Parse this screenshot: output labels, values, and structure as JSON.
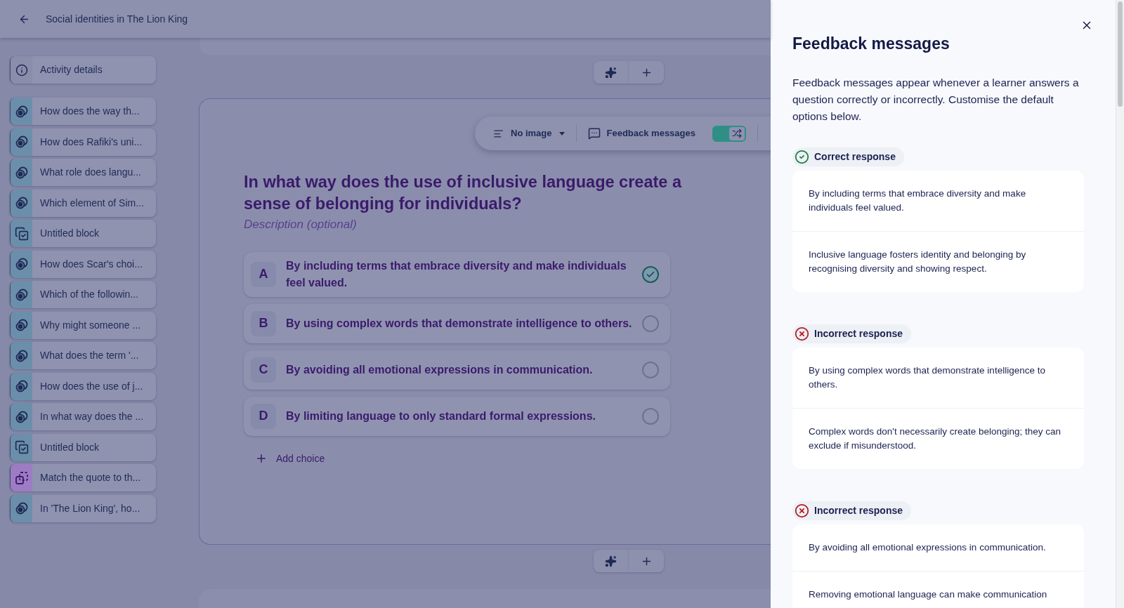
{
  "header": {
    "title": "Social identities in The Lion King"
  },
  "sidebar": {
    "details": {
      "label": "Activity details"
    },
    "items": [
      {
        "kind": "question",
        "label": "How does the way th..."
      },
      {
        "kind": "question",
        "label": "How does Rafiki's uni..."
      },
      {
        "kind": "question",
        "label": "What role does langu..."
      },
      {
        "kind": "question",
        "label": "Which element of Sim..."
      },
      {
        "kind": "block",
        "label": "Untitled block"
      },
      {
        "kind": "question",
        "label": "How does Scar's choi..."
      },
      {
        "kind": "question",
        "label": "Which of the followin..."
      },
      {
        "kind": "question",
        "label": "Why might someone ..."
      },
      {
        "kind": "question",
        "label": "What does the term '..."
      },
      {
        "kind": "question",
        "label": "How does the use of j..."
      },
      {
        "kind": "question",
        "label": "In what way does the ..."
      },
      {
        "kind": "block",
        "label": "Untitled block"
      },
      {
        "kind": "match",
        "label": "Match the quote to th..."
      },
      {
        "kind": "question",
        "label": "In 'The Lion King', ho..."
      }
    ]
  },
  "toolbar": {
    "image": "No image",
    "feedback": "Feedback messages",
    "shuffle_on": true
  },
  "question": {
    "title": "In what way does the use of inclusive language create a sense of belonging for individuals?",
    "description_placeholder": "Description (optional)",
    "choices": [
      {
        "letter": "A",
        "text": "By including terms that embrace diversity and make individuals feel valued.",
        "correct": true
      },
      {
        "letter": "B",
        "text": "By using complex words that demonstrate intelligence to others.",
        "correct": false
      },
      {
        "letter": "C",
        "text": "By avoiding all emotional expressions in communication.",
        "correct": false
      },
      {
        "letter": "D",
        "text": "By limiting language to only standard formal expressions.",
        "correct": false
      }
    ],
    "add_choice": "Add choice"
  },
  "drawer": {
    "title": "Feedback messages",
    "intro": "Feedback messages appear whenever a learner answers a question correctly or incorrectly. Customise the default options below.",
    "sections": [
      {
        "kind": "correct",
        "label": "Correct response",
        "messages": [
          "By including terms that embrace diversity and make individuals feel valued.",
          "Inclusive language fosters identity and belonging by recognising diversity and showing respect."
        ]
      },
      {
        "kind": "incorrect",
        "label": "Incorrect response",
        "messages": [
          "By using complex words that demonstrate intelligence to others.",
          "Complex words don't necessarily create belonging; they can exclude if misunderstood."
        ]
      },
      {
        "kind": "incorrect",
        "label": "Incorrect response",
        "messages": [
          "By avoiding all emotional expressions in communication.",
          "Removing emotional language can make communication"
        ]
      }
    ]
  }
}
